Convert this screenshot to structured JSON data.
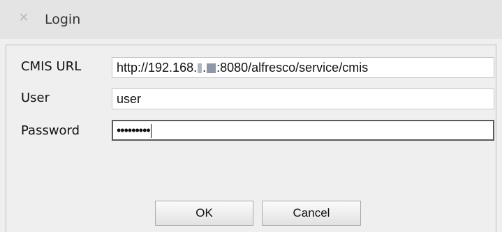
{
  "window": {
    "title": "Login",
    "close_icon": "close-icon"
  },
  "form": {
    "cmis_url": {
      "label": "CMIS URL",
      "value_prefix": "http://192.168.",
      "value_suffix": ":8080/alfresco/service/cmis"
    },
    "user": {
      "label": "User",
      "value": "user"
    },
    "password": {
      "label": "Password",
      "value": "•••••••••"
    }
  },
  "buttons": {
    "ok": "OK",
    "cancel": "Cancel"
  }
}
